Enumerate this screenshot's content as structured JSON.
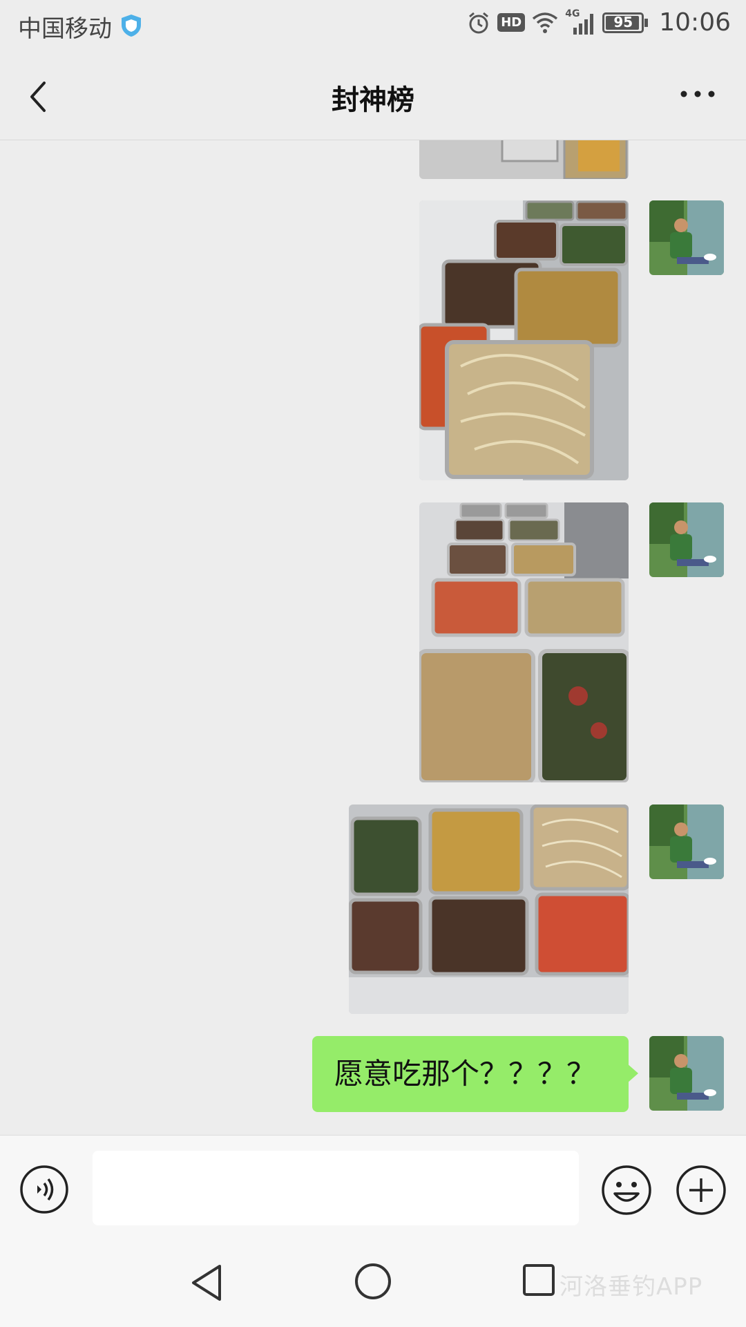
{
  "status_bar": {
    "carrier": "中国移动",
    "hd": "HD",
    "network": "4G",
    "battery": "95",
    "time": "10:06"
  },
  "header": {
    "title": "封神榜"
  },
  "messages": [
    {
      "type": "image",
      "description_icon": "food-tray-photo"
    },
    {
      "type": "image",
      "description_icon": "food-tray-photo"
    },
    {
      "type": "image",
      "description_icon": "food-tray-photo"
    },
    {
      "type": "image",
      "description_icon": "food-tray-photo"
    },
    {
      "type": "text",
      "text": "愿意吃那个？？？？"
    }
  ],
  "colors": {
    "bubble_green": "#95ec69",
    "background": "#ededed"
  },
  "watermark": "河洛垂钓APP"
}
